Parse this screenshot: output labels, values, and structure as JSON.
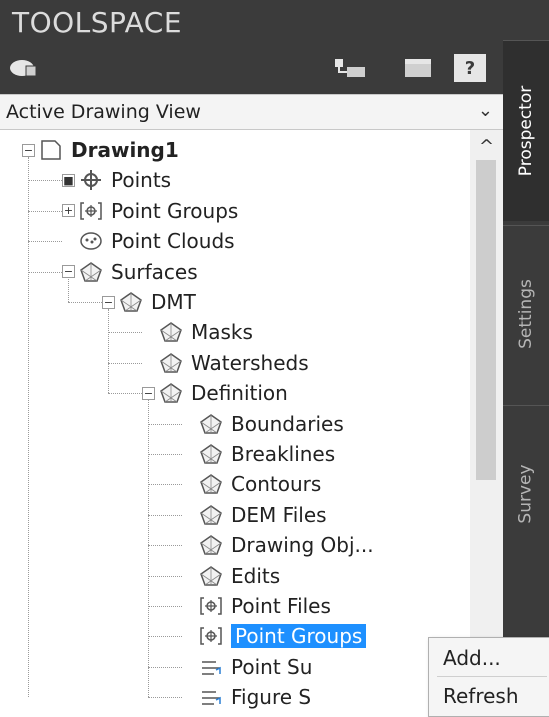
{
  "palette": {
    "header_bg": "#3b3b3b",
    "header_text": "#dcdcdc",
    "selection": "#1e90ff",
    "tab_active_text": "#ffffff",
    "tab_inactive_text": "#b5b5b5"
  },
  "header": {
    "title": "TOOLSPACE",
    "icons": [
      "settings-cloud-icon",
      "tree-view-icon",
      "panel-icon",
      "help-icon"
    ],
    "help_label": "?"
  },
  "view_select": {
    "value": "Active Drawing View",
    "arrow": "⌄"
  },
  "scrollbar": {
    "up_arrow": "^"
  },
  "tree": [
    {
      "label": "Drawing1",
      "icon": "drawing-icon",
      "expander": "−",
      "bold": true
    },
    {
      "label": "Points",
      "icon": "point-icon",
      "expander": "■"
    },
    {
      "label": "Point Groups",
      "icon": "point-groups-icon",
      "expander": "+"
    },
    {
      "label": "Point Clouds",
      "icon": "point-clouds-icon",
      "expander": ""
    },
    {
      "label": "Surfaces",
      "icon": "surfaces-icon",
      "expander": "−"
    },
    {
      "label": "DMT",
      "icon": "surface-icon",
      "expander": "−"
    },
    {
      "label": "Masks",
      "icon": "masks-icon",
      "expander": ""
    },
    {
      "label": "Watersheds",
      "icon": "watersheds-icon",
      "expander": ""
    },
    {
      "label": "Definition",
      "icon": "definition-icon",
      "expander": "−"
    },
    {
      "label": "Boundaries",
      "icon": "boundaries-icon",
      "expander": ""
    },
    {
      "label": "Breaklines",
      "icon": "breaklines-icon",
      "expander": ""
    },
    {
      "label": "Contours",
      "icon": "contours-icon",
      "expander": ""
    },
    {
      "label": "DEM Files",
      "icon": "dem-files-icon",
      "expander": ""
    },
    {
      "label": "Drawing Obj...",
      "icon": "drawing-objects-icon",
      "expander": ""
    },
    {
      "label": "Edits",
      "icon": "edits-icon",
      "expander": ""
    },
    {
      "label": "Point Files",
      "icon": "point-files-icon",
      "expander": ""
    },
    {
      "label": "Point Groups",
      "icon": "point-groups-icon",
      "expander": "",
      "selected": true
    },
    {
      "label": "Point Su",
      "icon": "point-survey-icon",
      "expander": ""
    },
    {
      "label": "Figure S",
      "icon": "figure-survey-icon",
      "expander": ""
    }
  ],
  "side_tabs": [
    {
      "label": "Prospector",
      "active": true
    },
    {
      "label": "Settings",
      "active": false
    },
    {
      "label": "Survey",
      "active": false
    }
  ],
  "context_menu": {
    "items": [
      "Add...",
      "Refresh"
    ]
  }
}
